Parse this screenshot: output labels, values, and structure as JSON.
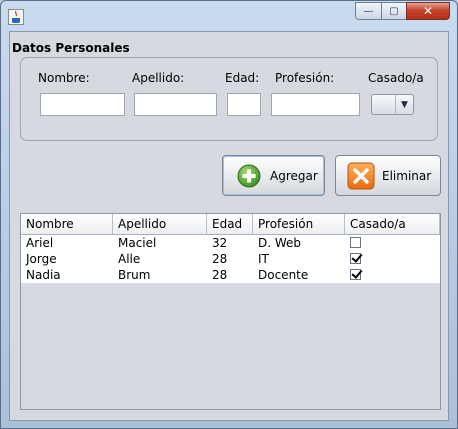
{
  "window": {
    "title": "",
    "buttons": {
      "minimize": "—",
      "maximize": "▢",
      "close": "✕"
    }
  },
  "section": {
    "title": "Datos Personales"
  },
  "form": {
    "labels": {
      "nombre": "Nombre:",
      "apellido": "Apellido:",
      "edad": "Edad:",
      "profesion": "Profesión:",
      "casado": "Casado/a"
    },
    "values": {
      "nombre": "",
      "apellido": "",
      "edad": "",
      "profesion": ""
    },
    "casado_selected": ""
  },
  "buttons": {
    "agregar": "Agregar",
    "eliminar": "Eliminar"
  },
  "table": {
    "columns": [
      "Nombre",
      "Apellido",
      "Edad",
      "Profesión",
      "Casado/a"
    ],
    "rows": [
      {
        "nombre": "Ariel",
        "apellido": "Maciel",
        "edad": "32",
        "profesion": "D. Web",
        "casado": false
      },
      {
        "nombre": "Jorge",
        "apellido": "Alle",
        "edad": "28",
        "profesion": "IT",
        "casado": true
      },
      {
        "nombre": "Nadia",
        "apellido": "Brum",
        "edad": "28",
        "profesion": "Docente",
        "casado": true
      }
    ]
  },
  "colors": {
    "add_icon": "#5aa832",
    "delete_icon": "#f07d1a",
    "close_button": "#c5432b"
  }
}
